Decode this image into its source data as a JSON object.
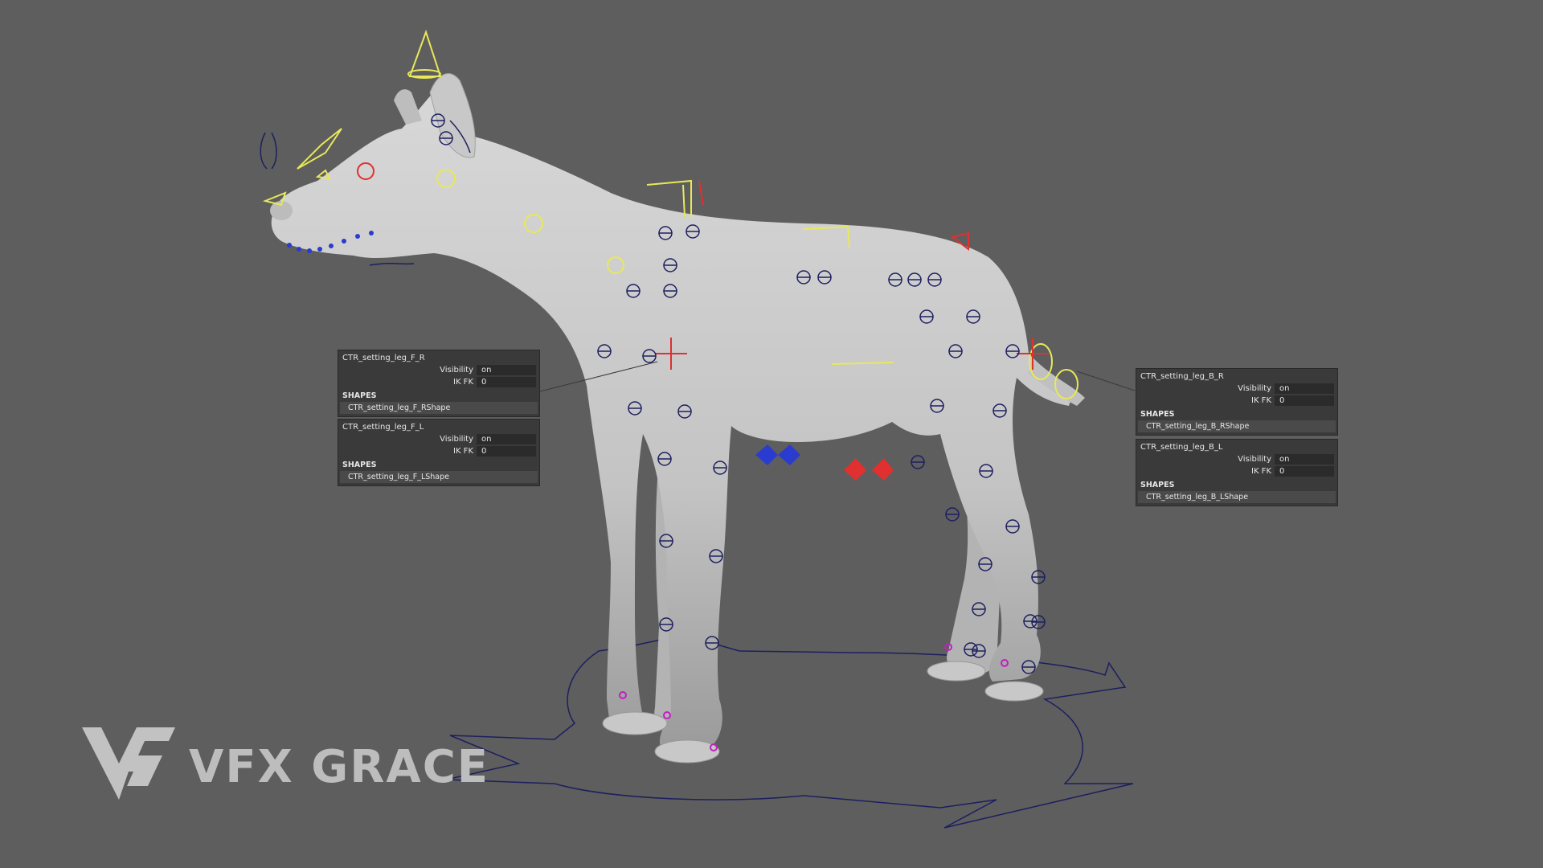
{
  "panels": [
    {
      "title": "CTR_setting_leg_F_R",
      "visibility_label": "Visibility",
      "visibility_value": "on",
      "ikfk_label": "IK FK",
      "ikfk_value": "0",
      "shapes_label": "SHAPES",
      "shape_name": "CTR_setting_leg_F_RShape"
    },
    {
      "title": "CTR_setting_leg_F_L",
      "visibility_label": "Visibility",
      "visibility_value": "on",
      "ikfk_label": "IK FK",
      "ikfk_value": "0",
      "shapes_label": "SHAPES",
      "shape_name": "CTR_setting_leg_F_LShape"
    },
    {
      "title": "CTR_setting_leg_B_R",
      "visibility_label": "Visibility",
      "visibility_value": "on",
      "ikfk_label": "IK FK",
      "ikfk_value": "0",
      "shapes_label": "SHAPES",
      "shape_name": "CTR_setting_leg_B_RShape"
    },
    {
      "title": "CTR_setting_leg_B_L",
      "visibility_label": "Visibility",
      "visibility_value": "on",
      "ikfk_label": "IK FK",
      "ikfk_value": "0",
      "shapes_label": "SHAPES",
      "shape_name": "CTR_setting_leg_B_LShape"
    }
  ],
  "watermark": {
    "text": "VFX GRACE"
  },
  "colors": {
    "background": "#5e5e5e",
    "model": "#cfcfcf",
    "control_blue": "#1c1f5e",
    "control_yellow": "#e8e85a",
    "control_red": "#e03030",
    "control_magenta": "#c020c0"
  }
}
